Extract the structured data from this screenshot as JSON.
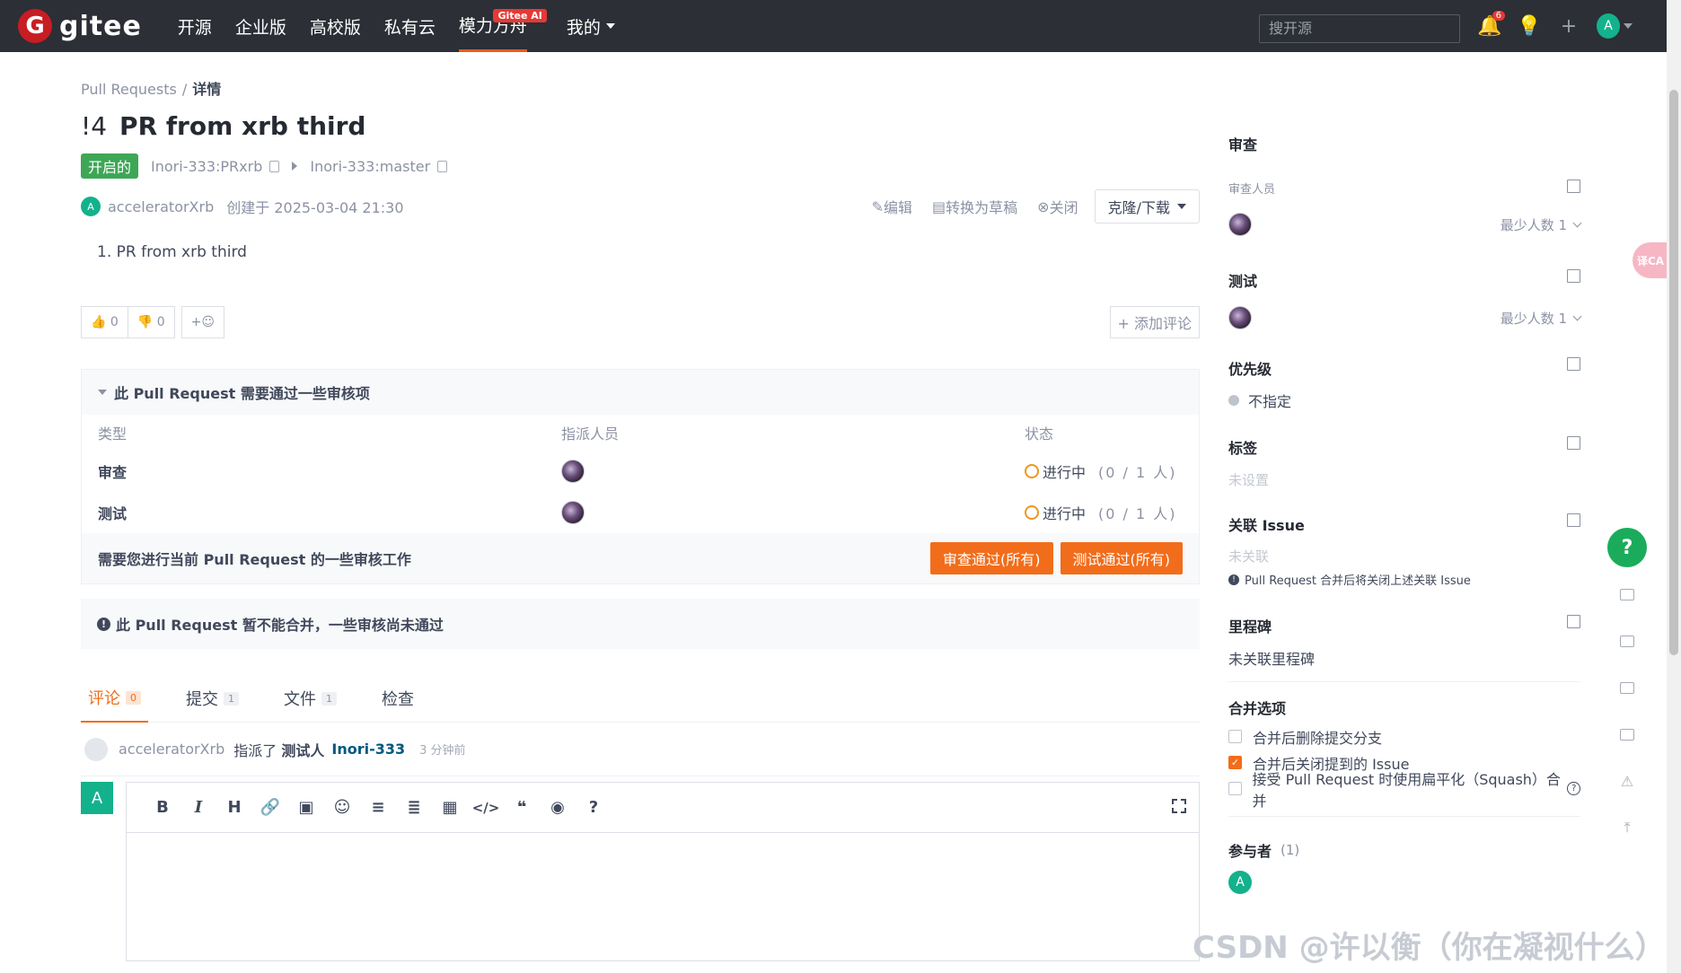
{
  "topbar": {
    "logo_letter": "G",
    "logo_text": "gitee",
    "nav": [
      "开源",
      "企业版",
      "高校版",
      "私有云",
      "模力方舟",
      "我的"
    ],
    "ai_badge": "Gitee AI",
    "search_placeholder": "搜开源",
    "notif_count": "6",
    "user_initial": "A"
  },
  "breadcrumb": {
    "root": "Pull Requests",
    "sep": "/",
    "current": "详情"
  },
  "pr": {
    "number": "!4",
    "title": "PR from xrb third",
    "status": "开启的",
    "source_branch": "Inori-333:PRxrb",
    "target_branch": "Inori-333:master",
    "author_initial": "A",
    "author": "acceleratorXrb",
    "created": "创建于 2025-03-04 21:30",
    "description": "1. PR from xrb third"
  },
  "actions": {
    "edit": "编辑",
    "draft": "转换为草稿",
    "close": "关闭",
    "clone": "克隆/下载"
  },
  "reactions": {
    "up_count": "0",
    "down_count": "0",
    "add_emoji": "+☺",
    "add_comment": "+ 添加评论"
  },
  "review_panel": {
    "title": "此 Pull Request 需要通过一些审核项",
    "headers": [
      "类型",
      "指派人员",
      "状态"
    ],
    "rows": [
      {
        "type": "审查",
        "status": "进行中",
        "count": "(0 / 1 人)"
      },
      {
        "type": "测试",
        "status": "进行中",
        "count": "(0 / 1 人)"
      }
    ],
    "footer_text": "需要您进行当前 Pull Request 的一些审核工作",
    "btn_review": "审查通过(所有)",
    "btn_test": "测试通过(所有)"
  },
  "merge_warning": "此 Pull Request 暂不能合并，一些审核尚未通过",
  "tabs": [
    {
      "label": "评论",
      "count": "0"
    },
    {
      "label": "提交",
      "count": "1"
    },
    {
      "label": "文件",
      "count": "1"
    },
    {
      "label": "检查",
      "count": ""
    }
  ],
  "activity": {
    "user": "acceleratorXrb",
    "verb": "指派了",
    "role": "测试人",
    "target": "Inori-333",
    "time": "3 分钟前"
  },
  "editor": {
    "avatar_initial": "A",
    "toolbar": [
      "B",
      "I",
      "H",
      "🔗",
      "▣",
      "☺",
      "≡",
      "≣",
      "▦",
      "</>",
      "❝",
      "◉",
      "?"
    ]
  },
  "sidebar": {
    "review": {
      "title": "审查",
      "sub": "审查人员",
      "min": "最少人数 1"
    },
    "test": {
      "title": "测试",
      "min": "最少人数 1"
    },
    "priority": {
      "title": "优先级",
      "value": "不指定"
    },
    "labels": {
      "title": "标签",
      "value": "未设置"
    },
    "issue": {
      "title": "关联 Issue",
      "value": "未关联",
      "note": "Pull Request 合并后将关闭上述关联 Issue"
    },
    "milestone": {
      "title": "里程碑",
      "value": "未关联里程碑"
    },
    "merge": {
      "title": "合并选项",
      "options": [
        {
          "label": "合并后删除提交分支",
          "checked": false
        },
        {
          "label": "合并后关闭提到的 Issue",
          "checked": true
        },
        {
          "label": "接受 Pull Request 时使用扁平化（Squash）合并",
          "checked": false
        }
      ]
    },
    "participants": {
      "title": "参与者",
      "count": "(1)",
      "initial": "A"
    }
  },
  "side_tab": "译CA",
  "watermark": "CSDN @许以衡（你在凝视什么）"
}
